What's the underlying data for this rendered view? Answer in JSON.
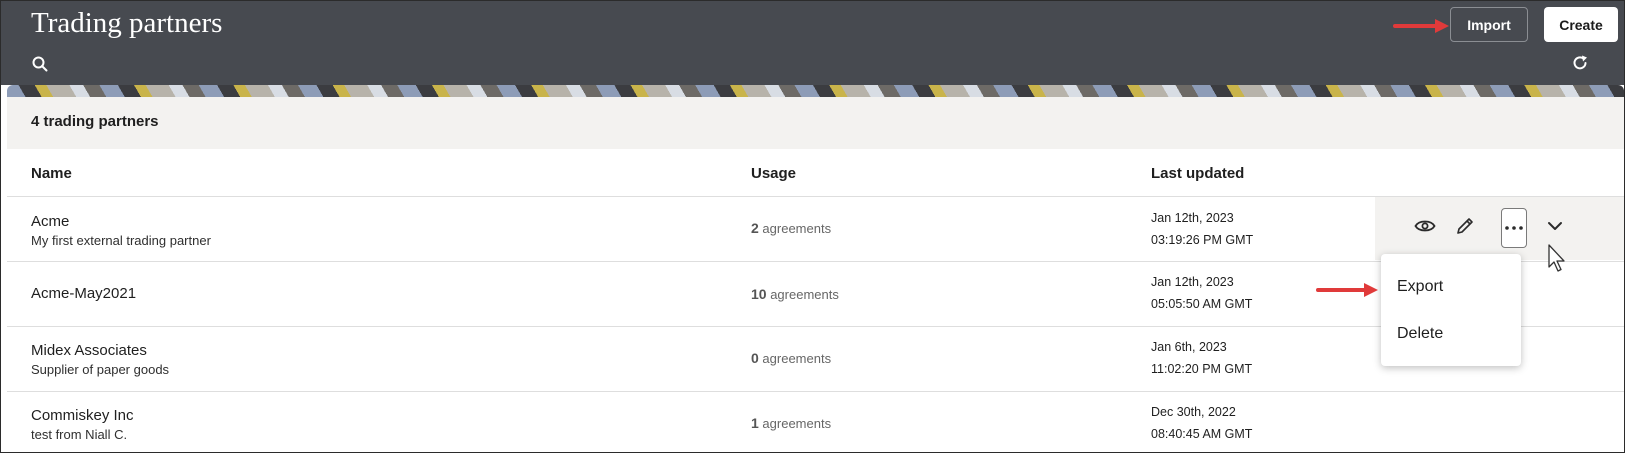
{
  "header": {
    "title": "Trading partners",
    "import_label": "Import",
    "create_label": "Create"
  },
  "summary": {
    "count_text": "4 trading partners"
  },
  "columns": {
    "name": "Name",
    "usage": "Usage",
    "last_updated": "Last updated"
  },
  "rows": [
    {
      "name": "Acme",
      "description": "My first external trading partner",
      "usage_count": "2",
      "usage_unit": "agreements",
      "date": "Jan 12th, 2023",
      "time": "03:19:26 PM GMT"
    },
    {
      "name": "Acme-May2021",
      "description": "",
      "usage_count": "10",
      "usage_unit": "agreements",
      "date": "Jan 12th, 2023",
      "time": "05:05:50 AM GMT"
    },
    {
      "name": "Midex Associates",
      "description": "Supplier of paper goods",
      "usage_count": "0",
      "usage_unit": "agreements",
      "date": "Jan 6th, 2023",
      "time": "11:02:20 PM GMT"
    },
    {
      "name": "Commiskey Inc",
      "description": "test from Niall C.",
      "usage_count": "1",
      "usage_unit": "agreements",
      "date": "Dec 30th, 2022",
      "time": "08:40:45 AM GMT"
    }
  ],
  "menu": {
    "export": "Export",
    "delete": "Delete"
  },
  "colors": {
    "header_bg": "#474a50",
    "accent_arrow": "#e03a3a",
    "panel_bg": "#f3f2f0"
  }
}
